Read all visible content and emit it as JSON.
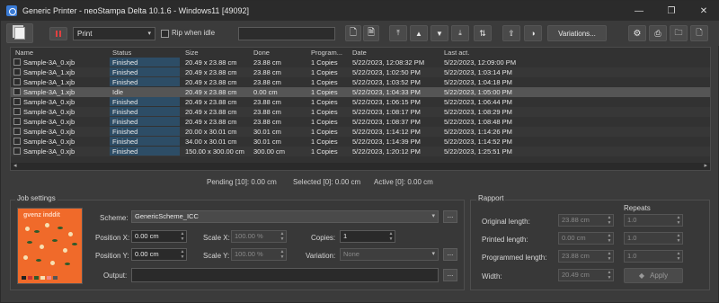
{
  "window": {
    "title": "Generic Printer - neoStampa Delta 10.1.6 - Windows11 [49092]",
    "minimize": "—",
    "maximize": "❐",
    "close": "✕"
  },
  "toolbar": {
    "mode_select": "Print",
    "rip_when_idle_label": "Rip when idle",
    "rip_when_idle_checked": false,
    "variations_label": "Variations..."
  },
  "table": {
    "columns": [
      "Name",
      "Status",
      "Size",
      "Done",
      "Program...",
      "Date",
      "Last act."
    ],
    "rows": [
      {
        "name": "Sample-3A_0.xjb",
        "status": "Finished",
        "size": "20.49 x 23.88 cm",
        "done": "23.88 cm",
        "program": "1 Copies",
        "date": "5/22/2023, 12:08:32 PM",
        "last": "5/22/2023, 12:09:00 PM"
      },
      {
        "name": "Sample-3A_1.xjb",
        "status": "Finished",
        "size": "20.49 x 23.88 cm",
        "done": "23.88 cm",
        "program": "1 Copies",
        "date": "5/22/2023, 1:02:50 PM",
        "last": "5/22/2023, 1:03:14 PM"
      },
      {
        "name": "Sample-3A_1.xjb",
        "status": "Finished",
        "size": "20.49 x 23.88 cm",
        "done": "23.88 cm",
        "program": "1 Copies",
        "date": "5/22/2023, 1:03:52 PM",
        "last": "5/22/2023, 1:04:18 PM"
      },
      {
        "name": "Sample-3A_1.xjb",
        "status": "Idle",
        "size": "20.49 x 23.88 cm",
        "done": "0.00 cm",
        "program": "1 Copies",
        "date": "5/22/2023, 1:04:33 PM",
        "last": "5/22/2023, 1:05:00 PM"
      },
      {
        "name": "Sample-3A_0.xjb",
        "status": "Finished",
        "size": "20.49 x 23.88 cm",
        "done": "23.88 cm",
        "program": "1 Copies",
        "date": "5/22/2023, 1:06:15 PM",
        "last": "5/22/2023, 1:06:44 PM"
      },
      {
        "name": "Sample-3A_0.xjb",
        "status": "Finished",
        "size": "20.49 x 23.88 cm",
        "done": "23.88 cm",
        "program": "1 Copies",
        "date": "5/22/2023, 1:08:17 PM",
        "last": "5/22/2023, 1:08:29 PM"
      },
      {
        "name": "Sample-3A_0.xjb",
        "status": "Finished",
        "size": "20.49 x 23.88 cm",
        "done": "23.88 cm",
        "program": "1 Copies",
        "date": "5/22/2023, 1:08:37 PM",
        "last": "5/22/2023, 1:08:48 PM"
      },
      {
        "name": "Sample-3A_0.xjb",
        "status": "Finished",
        "size": "20.00 x 30.01 cm",
        "done": "30.01 cm",
        "program": "1 Copies",
        "date": "5/22/2023, 1:14:12 PM",
        "last": "5/22/2023, 1:14:26 PM"
      },
      {
        "name": "Sample-3A_0.xjb",
        "status": "Finished",
        "size": "34.00 x 30.01 cm",
        "done": "30.01 cm",
        "program": "1 Copies",
        "date": "5/22/2023, 1:14:39 PM",
        "last": "5/22/2023, 1:14:52 PM"
      },
      {
        "name": "Sample-3A_0.xjb",
        "status": "Finished",
        "size": "150.00 x 300.00 cm",
        "done": "300.00 cm",
        "program": "1 Copies",
        "date": "5/22/2023, 1:20:12 PM",
        "last": "5/22/2023, 1:25:51 PM"
      }
    ]
  },
  "summary": {
    "pending": "Pending [10]: 0.00 cm",
    "selected": "Selected [0]: 0.00 cm",
    "active": "Active [0]: 0.00 cm"
  },
  "job_settings": {
    "title": "Job settings",
    "thumbnail_brand": "gvenz  inddit",
    "scheme_label": "Scheme:",
    "scheme_value": "GenericScheme_ICC",
    "position_x_label": "Position X:",
    "position_x_value": "0.00 cm",
    "position_y_label": "Position Y:",
    "position_y_value": "0.00 cm",
    "scale_x_label": "Scale X:",
    "scale_x_value": "100.00 %",
    "scale_y_label": "Scale Y:",
    "scale_y_value": "100.00 %",
    "copies_label": "Copies:",
    "copies_value": "1",
    "variation_label": "Variation:",
    "variation_value": "None",
    "output_label": "Output:",
    "output_value": "",
    "dots": "..."
  },
  "rapport": {
    "title": "Rapport",
    "repeats_label": "Repeats",
    "original_length_label": "Original length:",
    "original_length_value": "23.88 cm",
    "original_repeats": "1.0",
    "printed_length_label": "Printed length:",
    "printed_length_value": "0.00 cm",
    "printed_repeats": "1.0",
    "programmed_length_label": "Programmed length:",
    "programmed_length_value": "23.88 cm",
    "programmed_repeats": "1.0",
    "width_label": "Width:",
    "width_value": "20.49 cm",
    "apply_label": "Apply"
  },
  "colors": {
    "status_finished_bg": "#2d4d66",
    "stop_red": "#e04040",
    "thumbnail_orange": "#f06a2a"
  }
}
